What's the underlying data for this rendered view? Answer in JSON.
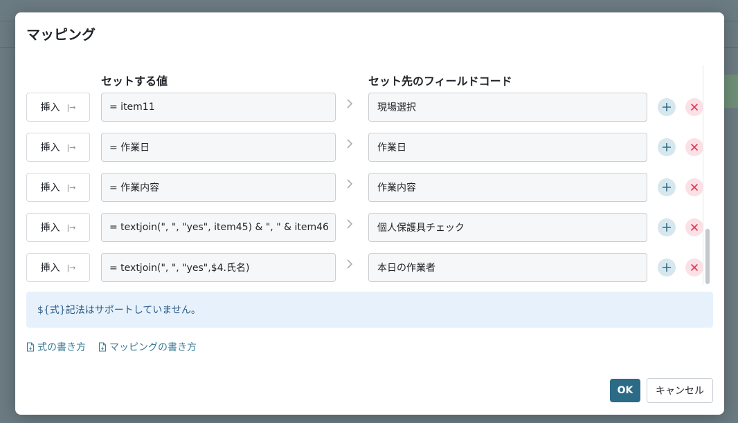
{
  "dialog": {
    "title": "マッピング"
  },
  "columns": {
    "value_header": "セットする値",
    "target_header": "セット先のフィールドコード"
  },
  "rows": [
    {
      "insert_label": "挿入",
      "value": "= item11",
      "target": "現場選択"
    },
    {
      "insert_label": "挿入",
      "value": "= 作業日",
      "target": "作業日"
    },
    {
      "insert_label": "挿入",
      "value": "= 作業内容",
      "target": "作業内容"
    },
    {
      "insert_label": "挿入",
      "value": "= textjoin(\", \", \"yes\", item45) & \", \" & item46",
      "target": "個人保護具チェック"
    },
    {
      "insert_label": "挿入",
      "value": "= textjoin(\", \", \"yes\",$4.氏名)",
      "target": "本日の作業者"
    }
  ],
  "notice": {
    "text": "${式}記法はサポートしていません。"
  },
  "links": {
    "formula_help": "式の書き方",
    "mapping_help": "マッピングの書き方"
  },
  "footer": {
    "ok_label": "OK",
    "cancel_label": "キャンセル"
  },
  "icons": {
    "insert": "insert-arrow-icon",
    "separator": "chevron-right-icon",
    "add": "plus-icon",
    "remove": "close-icon",
    "doc": "document-icon"
  },
  "colors": {
    "primary": "#2b6b86",
    "danger": "#e0395a",
    "notice_bg": "#e6f1fb",
    "link": "#3a7b96"
  }
}
